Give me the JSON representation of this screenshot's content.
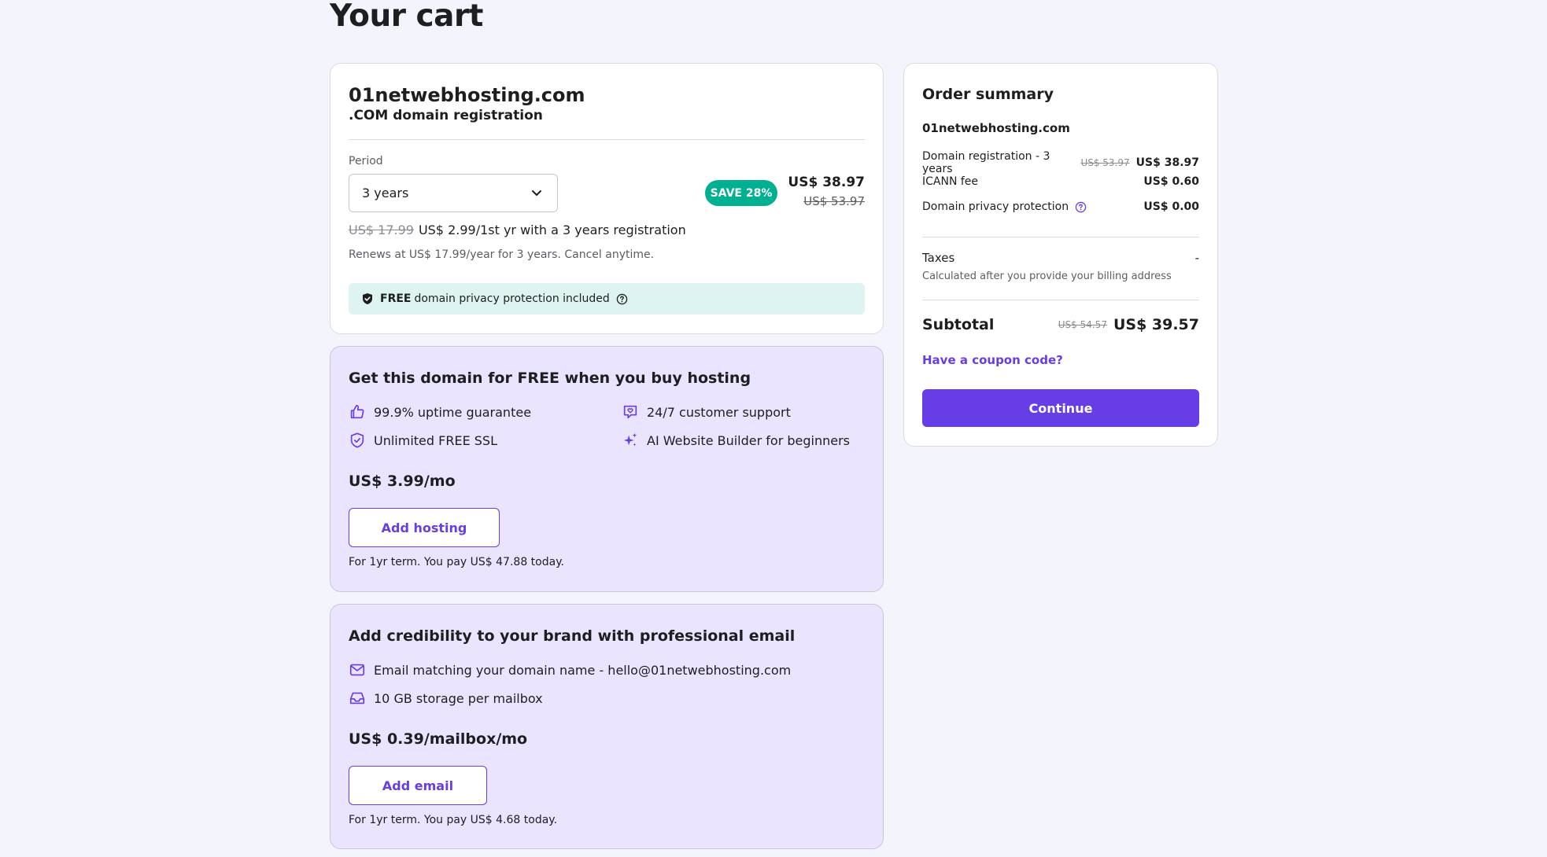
{
  "page": {
    "title": "Your cart"
  },
  "domain_card": {
    "domain": "01netwebhosting.com",
    "product": ".COM domain registration",
    "period_label": "Period",
    "period_value": "3 years",
    "save_badge": "SAVE 28%",
    "price_now": "US$ 38.97",
    "price_was": "US$ 53.97",
    "intro_strike": "US$ 17.99",
    "intro_text": "US$ 2.99/1st yr with a 3 years registration",
    "renew_text": "Renews at US$ 17.99/year for 3 years. Cancel anytime.",
    "privacy_free": "FREE",
    "privacy_text": "domain privacy protection included"
  },
  "hosting_promo": {
    "title": "Get this domain for FREE when you buy hosting",
    "features": [
      "99.9% uptime guarantee",
      "24/7 customer support",
      "Unlimited FREE SSL",
      "AI Website Builder for beginners"
    ],
    "price": "US$ 3.99/mo",
    "button": "Add hosting",
    "note": "For 1yr term. You pay US$ 47.88 today."
  },
  "email_promo": {
    "title": "Add credibility to your brand with professional email",
    "features": [
      "Email matching your domain name - hello@01netwebhosting.com",
      "10 GB storage per mailbox"
    ],
    "price": "US$ 0.39/mailbox/mo",
    "button": "Add email",
    "note": "For 1yr term. You pay US$ 4.68 today."
  },
  "summary": {
    "title": "Order summary",
    "domain": "01netwebhosting.com",
    "rows": [
      {
        "label": "Domain registration - 3 years",
        "old": "US$ 53.97",
        "amount": "US$ 38.97"
      },
      {
        "label": "ICANN fee",
        "amount": "US$ 0.60"
      },
      {
        "label": "Domain privacy protection",
        "amount": "US$ 0.00"
      }
    ],
    "taxes_label": "Taxes",
    "taxes_value": "-",
    "taxes_note": "Calculated after you provide your billing address",
    "subtotal_label": "Subtotal",
    "subtotal_old": "US$ 54.57",
    "subtotal_amount": "US$ 39.57",
    "coupon_link": "Have a coupon code?",
    "continue_button": "Continue"
  },
  "colors": {
    "accent": "#673de6",
    "save_badge": "#00b090",
    "privacy_banner": "#def4f0",
    "promo_bg": "#ebe4ff",
    "page_bg": "#f4f4fd"
  },
  "icons": {
    "privacy": "shield-check-icon",
    "help": "question-circle-icon",
    "uptime": "thumbs-up-icon",
    "support": "chat-heart-icon",
    "ssl": "shield-check-icon",
    "ai": "sparkles-icon",
    "email": "envelope-icon",
    "storage": "inbox-tray-icon"
  }
}
